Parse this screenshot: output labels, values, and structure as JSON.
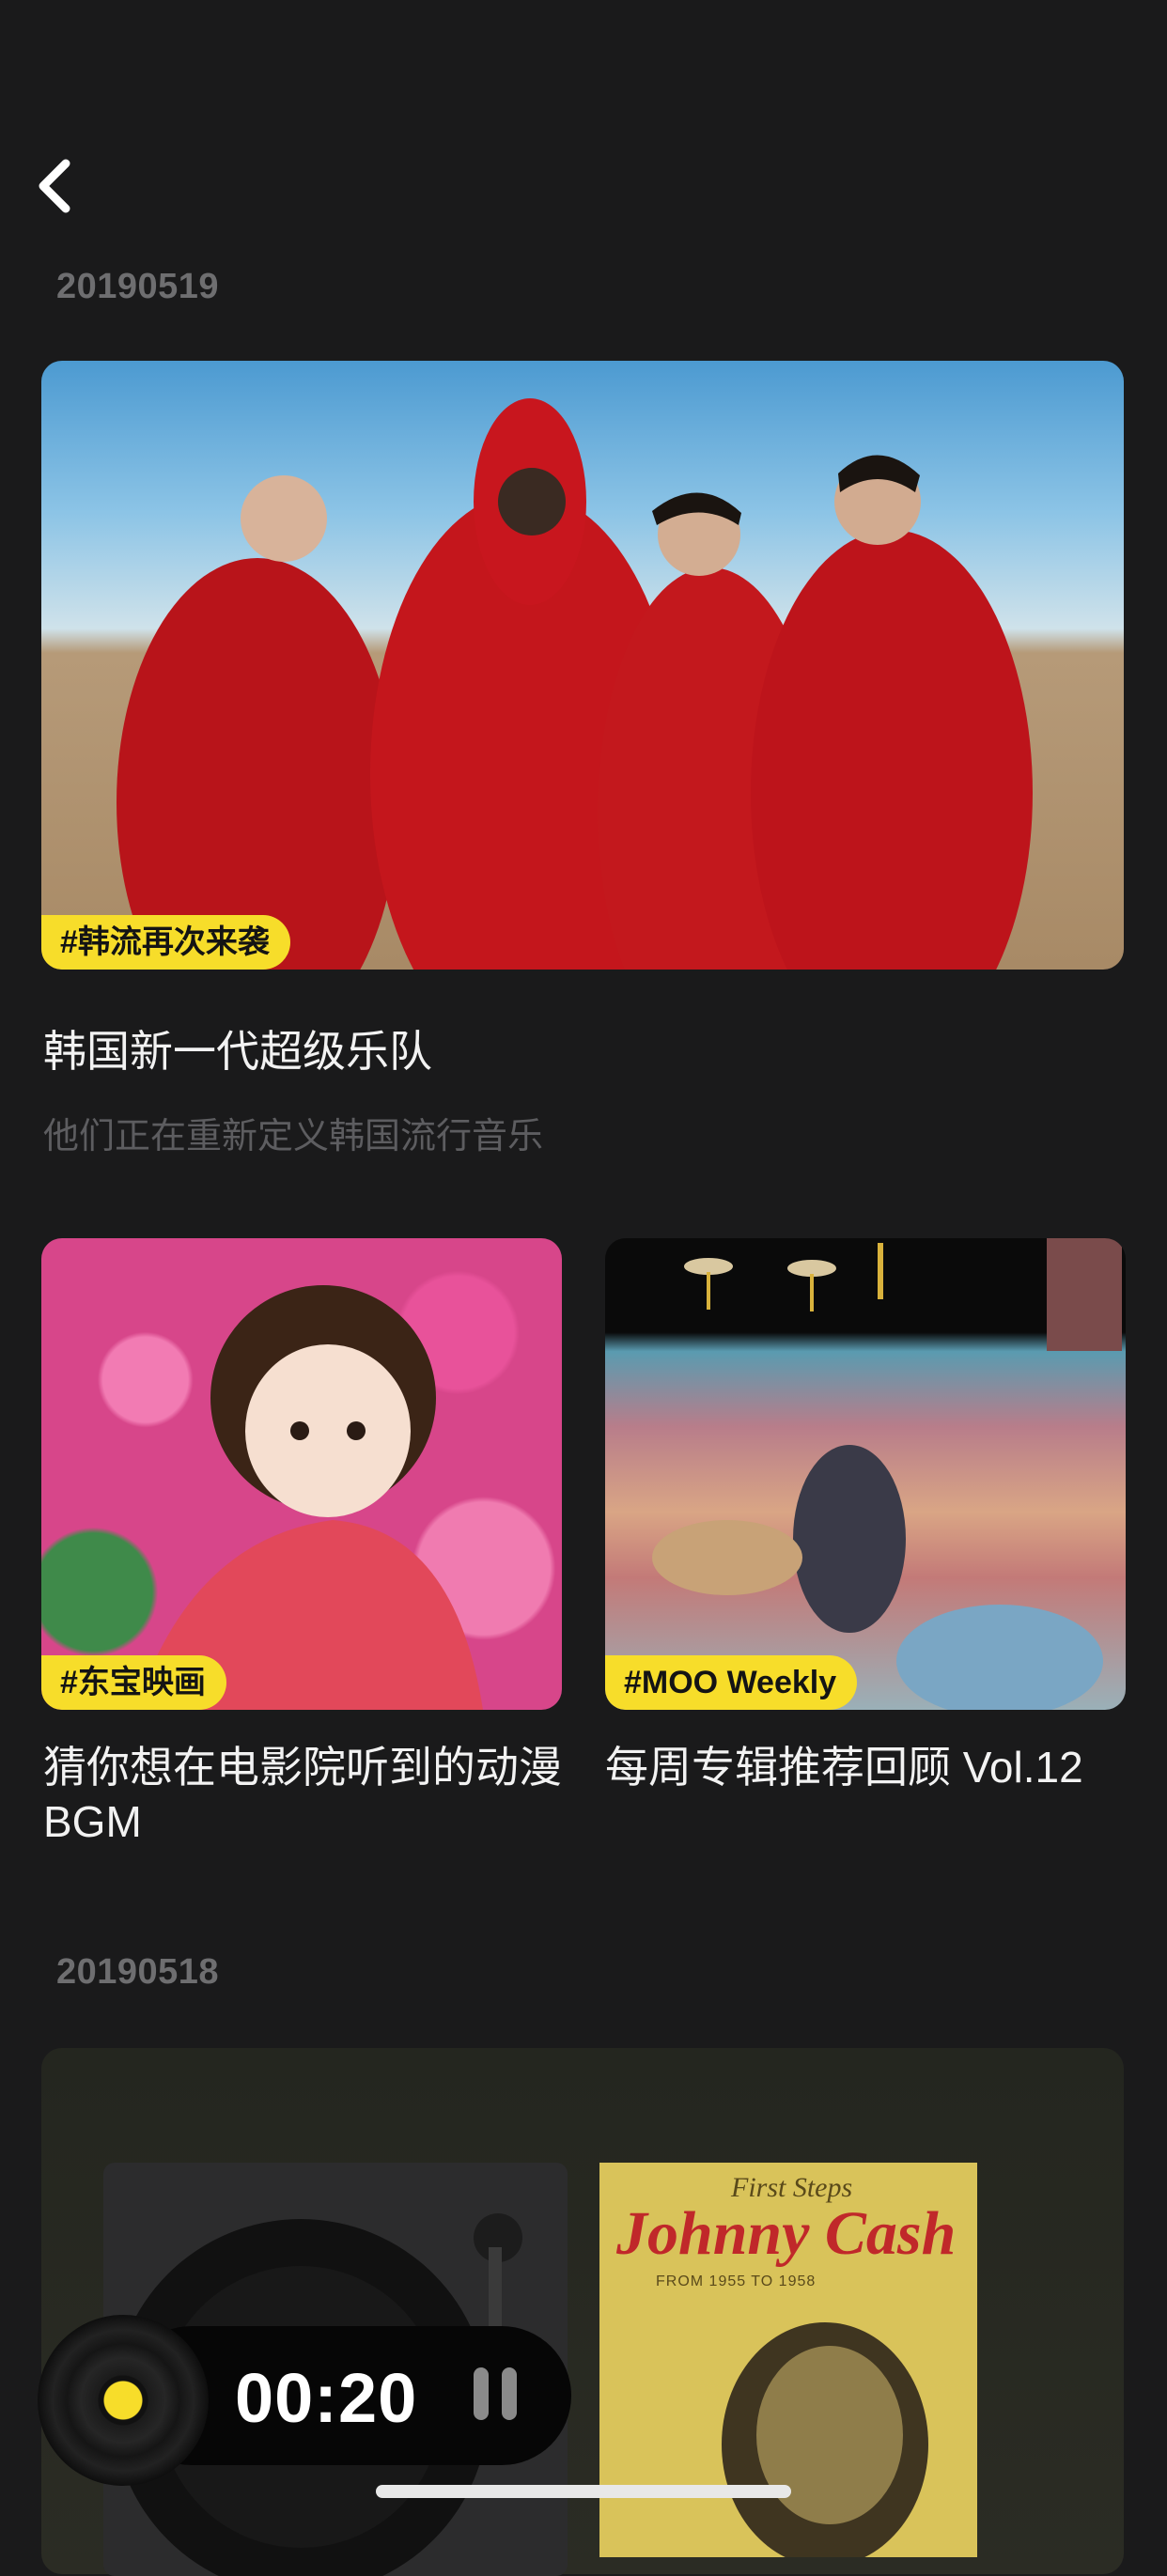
{
  "header": {
    "back_icon": "chevron-left-icon"
  },
  "sections": [
    {
      "date": "20190519",
      "featured": {
        "tag": "#韩流再次来袭",
        "title": "韩国新一代超级乐队",
        "subtitle": "他们正在重新定义韩国流行音乐"
      },
      "cards": [
        {
          "tag": "#东宝映画",
          "title": "猜你想在电影院听到的动漫 BGM"
        },
        {
          "tag": "#MOO Weekly",
          "title": "每周专辑推荐回顾 Vol.12"
        }
      ]
    },
    {
      "date": "20190518",
      "album": {
        "title_script": "First Steps",
        "artist": "Johnny Cash",
        "years": "FROM 1955 TO 1958"
      }
    }
  ],
  "player": {
    "time": "00:20",
    "pause_icon": "pause-icon",
    "disc_icon": "vinyl-disc-icon"
  },
  "colors": {
    "accent": "#f7dd2a",
    "background": "#1a1a1b"
  }
}
